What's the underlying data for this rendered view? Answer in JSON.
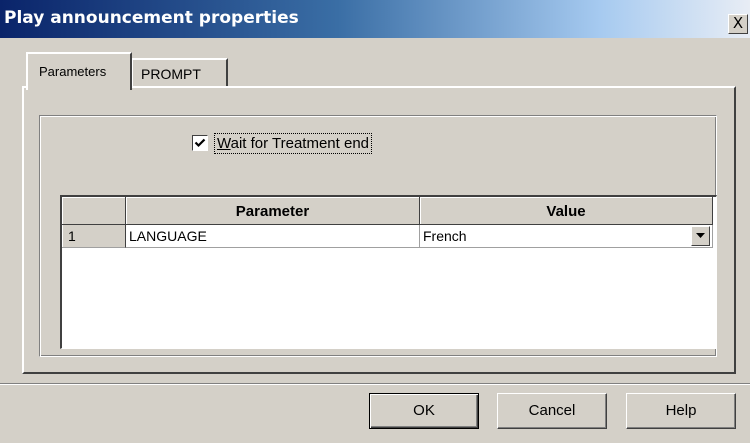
{
  "window": {
    "title": "Play announcement properties",
    "close_label": "X"
  },
  "tabs": [
    {
      "label": "Parameters",
      "active": true
    },
    {
      "label": "PROMPT",
      "active": false
    }
  ],
  "options": {
    "wait_checkbox": {
      "label_prefix": "W",
      "label_rest": "ait for Treatment end",
      "checked": true
    }
  },
  "grid": {
    "columns": [
      "",
      "Parameter",
      "Value"
    ],
    "rows": [
      {
        "num": "1",
        "parameter": "LANGUAGE",
        "value": "French"
      }
    ]
  },
  "buttons": {
    "ok": "OK",
    "cancel": "Cancel",
    "help": "Help"
  },
  "icons": {
    "close": "close-icon",
    "check": "checkmark-icon",
    "dropdown": "chevron-down-icon"
  },
  "colors": {
    "title_start": "#0a246a",
    "title_end": "#a6caf0",
    "face": "#d4d0c8"
  }
}
